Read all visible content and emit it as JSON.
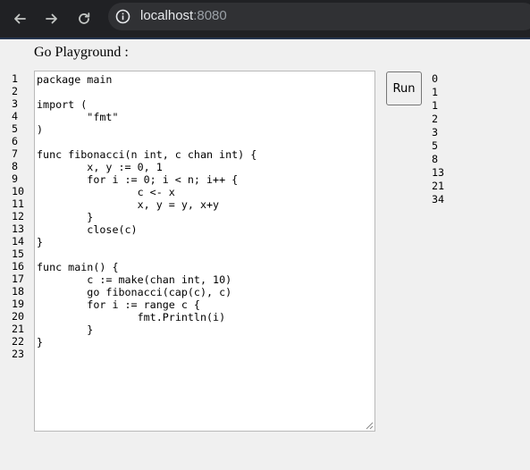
{
  "browser": {
    "url_host": "localhost",
    "url_port": ":8080",
    "icons": [
      "back-arrow-icon",
      "forward-arrow-icon",
      "reload-icon",
      "info-icon"
    ],
    "colors": {
      "toolbar": "#202124",
      "omnibox": "#303134",
      "url_text": "#e8eaed",
      "url_port": "#9aa0a6"
    }
  },
  "page": {
    "title": "Go Playground :",
    "run_label": "Run"
  },
  "editor": {
    "line_numbers": [
      "1",
      "2",
      "3",
      "4",
      "5",
      "6",
      "7",
      "8",
      "9",
      "10",
      "11",
      "12",
      "13",
      "14",
      "15",
      "16",
      "17",
      "18",
      "19",
      "20",
      "21",
      "22",
      "23"
    ],
    "lines": [
      "package main",
      "",
      "import (",
      "\t\"fmt\"",
      ")",
      "",
      "func fibonacci(n int, c chan int) {",
      "\tx, y := 0, 1",
      "\tfor i := 0; i < n; i++ {",
      "\t\tc <- x",
      "\t\tx, y = y, x+y",
      "\t}",
      "\tclose(c)",
      "}",
      "",
      "func main() {",
      "\tc := make(chan int, 10)",
      "\tgo fibonacci(cap(c), c)",
      "\tfor i := range c {",
      "\t\tfmt.Println(i)",
      "\t}",
      "}",
      ""
    ]
  },
  "output": {
    "lines": [
      "0",
      "1",
      "1",
      "2",
      "3",
      "5",
      "8",
      "13",
      "21",
      "34"
    ]
  }
}
